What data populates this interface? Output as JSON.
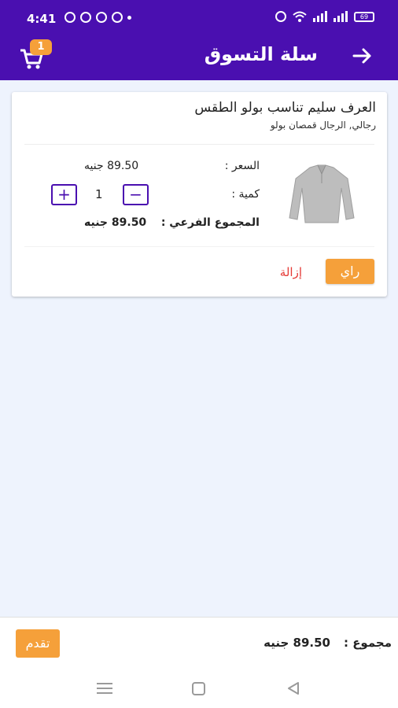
{
  "status_bar": {
    "time": "4:41",
    "battery": "69"
  },
  "app_bar": {
    "title": "سلة التسوق",
    "cart_badge": "1"
  },
  "cart_item": {
    "name": "العرف سليم تناسب بولو الطقس",
    "category": "رجالي, الرجال قمصان بولو",
    "price_label": "السعر :",
    "price_value": "89.50 جنيه",
    "quantity_label": "كمية :",
    "quantity": "1",
    "minus_symbol": "−",
    "plus_symbol": "+",
    "subtotal_label": "المجموع الفرعي :",
    "subtotal_value": "89.50 جنيه",
    "remove_label": "إزالة",
    "review_label": "راي"
  },
  "footer": {
    "total_label": "مجموع :",
    "total_value": "89.50 جنيه",
    "proceed_label": "تقدم"
  },
  "icons": {
    "back": "arrow-right-icon",
    "cart": "shopping-cart-icon",
    "nav_menu": "menu-icon",
    "nav_home": "home-square-icon",
    "nav_back": "back-triangle-icon"
  },
  "colors": {
    "primary": "#4a0fb0",
    "accent": "#f5a03a",
    "danger": "#e53935",
    "background": "#eef3fd"
  }
}
